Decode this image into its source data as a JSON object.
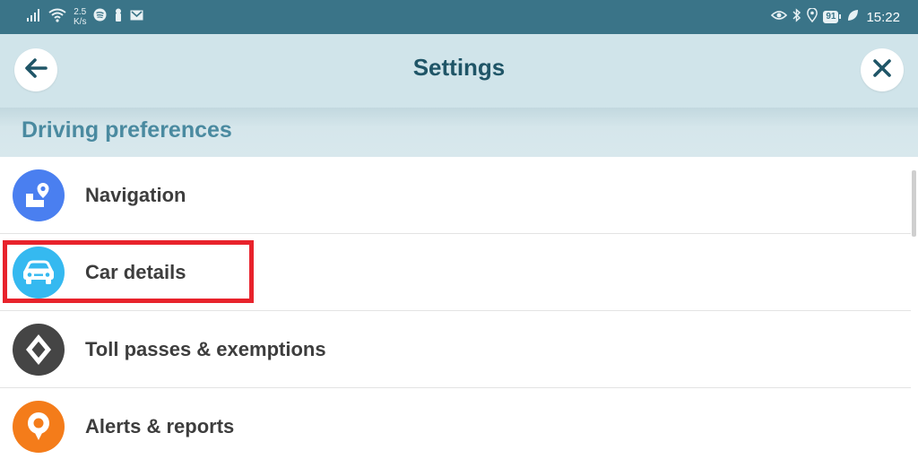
{
  "status_bar": {
    "net_speed_value": "2.5",
    "net_speed_unit": "K/s",
    "battery": "91",
    "time": "15:22",
    "icons_left": [
      "signal-icon",
      "wifi-icon",
      "spotify-icon",
      "notification-icon",
      "gmail-icon"
    ],
    "icons_right": [
      "eye-icon",
      "bluetooth-icon",
      "location-icon",
      "battery-icon",
      "leaf-icon"
    ]
  },
  "header": {
    "title": "Settings",
    "back_icon": "arrow-left-icon",
    "close_icon": "close-icon"
  },
  "section": {
    "title": "Driving preferences"
  },
  "items": [
    {
      "label": "Navigation",
      "icon": "map-pin-icon",
      "color": "#4a7ff0"
    },
    {
      "label": "Car details",
      "icon": "car-icon",
      "color": "#35b9f0"
    },
    {
      "label": "Toll passes & exemptions",
      "icon": "diamond-icon",
      "color": "#454545"
    },
    {
      "label": "Alerts & reports",
      "icon": "report-pin-icon",
      "color": "#f47c1a"
    }
  ],
  "colors": {
    "status_bar": "#3a7488",
    "header_bg": "#d0e4ea",
    "title": "#1f5567",
    "section_title": "#4a8aa0",
    "highlight": "#e8232c"
  }
}
